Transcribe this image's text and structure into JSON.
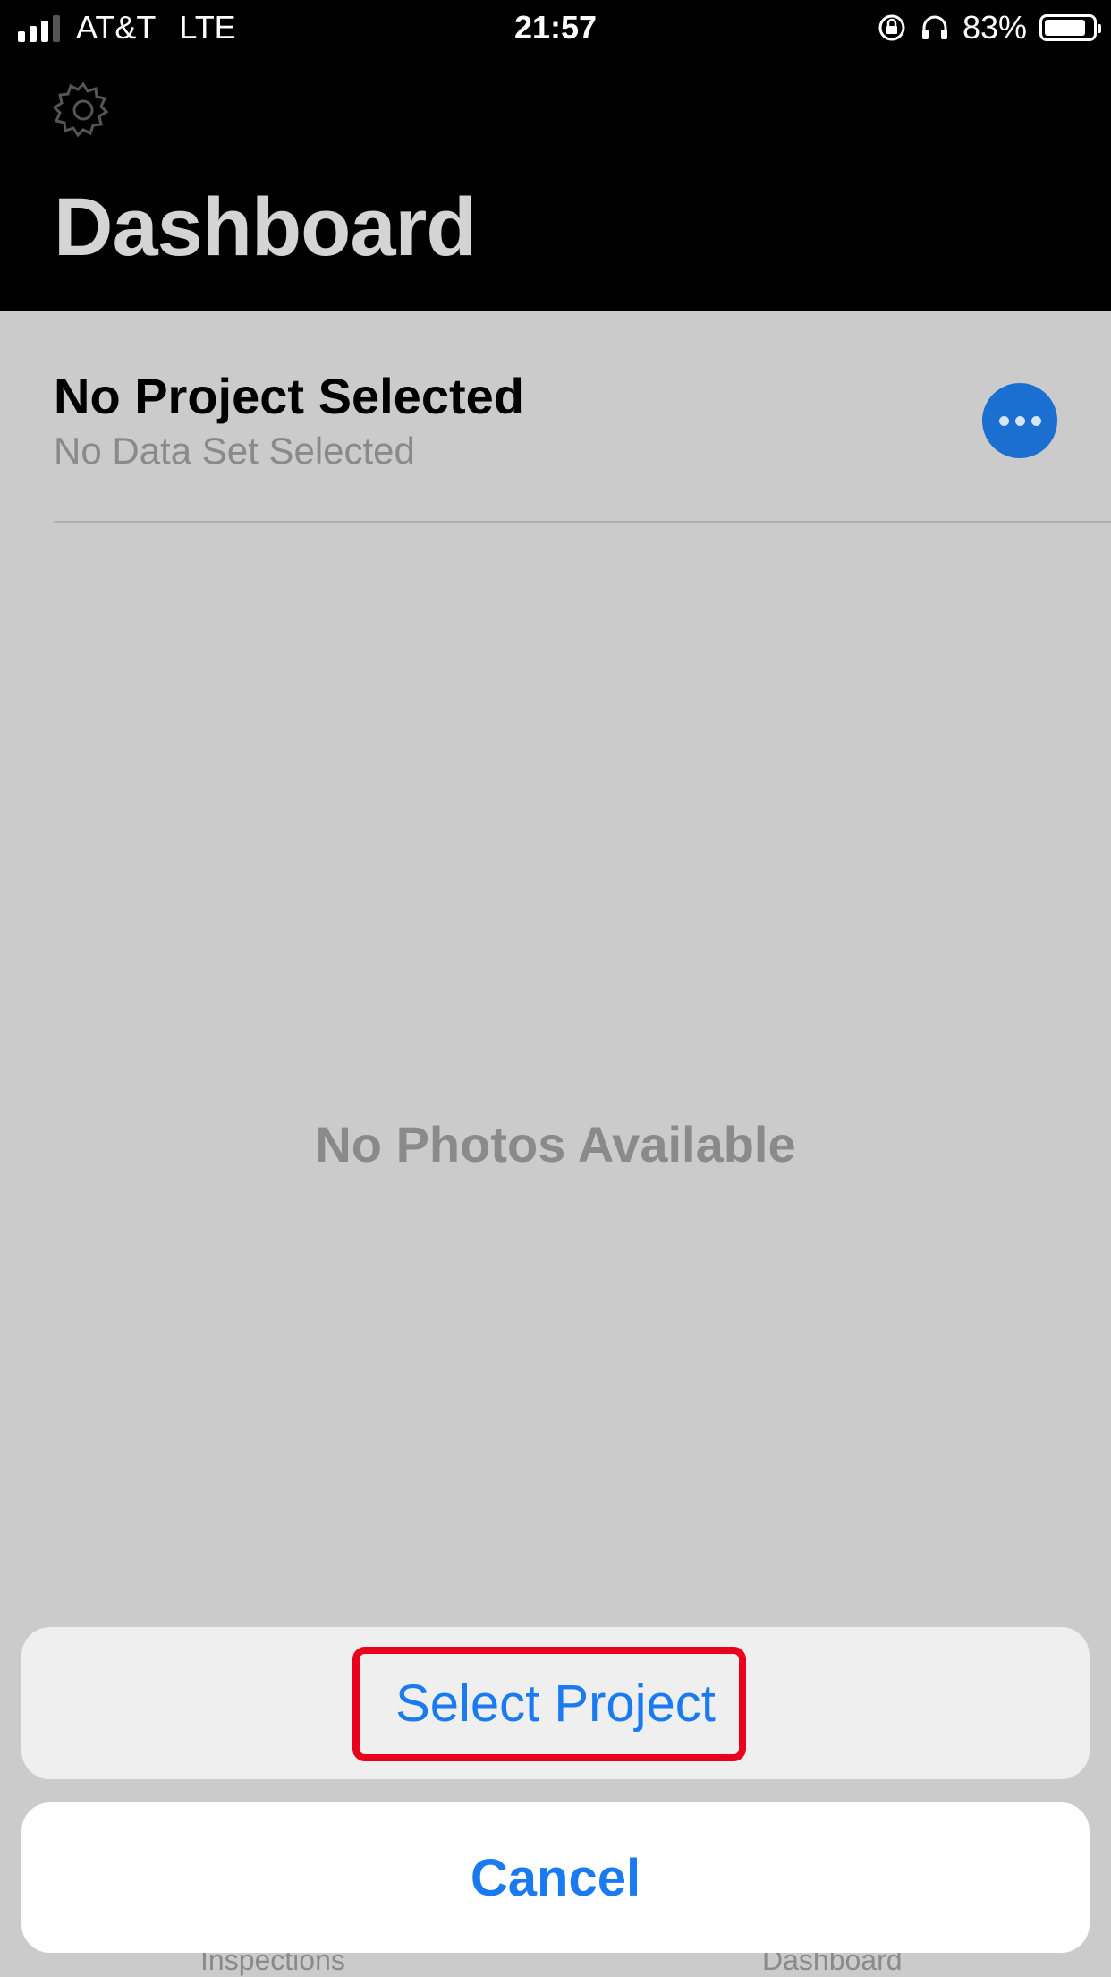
{
  "status_bar": {
    "carrier": "AT&T",
    "network": "LTE",
    "time": "21:57",
    "battery_percent": "83%",
    "battery_level": 0.83,
    "icons": [
      "signal-icon",
      "orientation-lock-icon",
      "headphones-icon",
      "battery-icon"
    ]
  },
  "header": {
    "title": "Dashboard",
    "settings_icon": "gear-icon"
  },
  "project": {
    "title": "No Project Selected",
    "subtitle": "No Data Set Selected",
    "more_icon": "ellipsis-icon"
  },
  "content": {
    "empty_message": "No Photos Available"
  },
  "tab_bar": {
    "items": [
      {
        "label": "Inspections"
      },
      {
        "label": "Dashboard"
      }
    ]
  },
  "action_sheet": {
    "actions": [
      {
        "label": "Select Project"
      }
    ],
    "cancel_label": "Cancel"
  },
  "colors": {
    "accent": "#1a7bf0",
    "highlight": "#e8001c",
    "header_bg": "#000000",
    "dim_bg": "#cbcbcb"
  }
}
